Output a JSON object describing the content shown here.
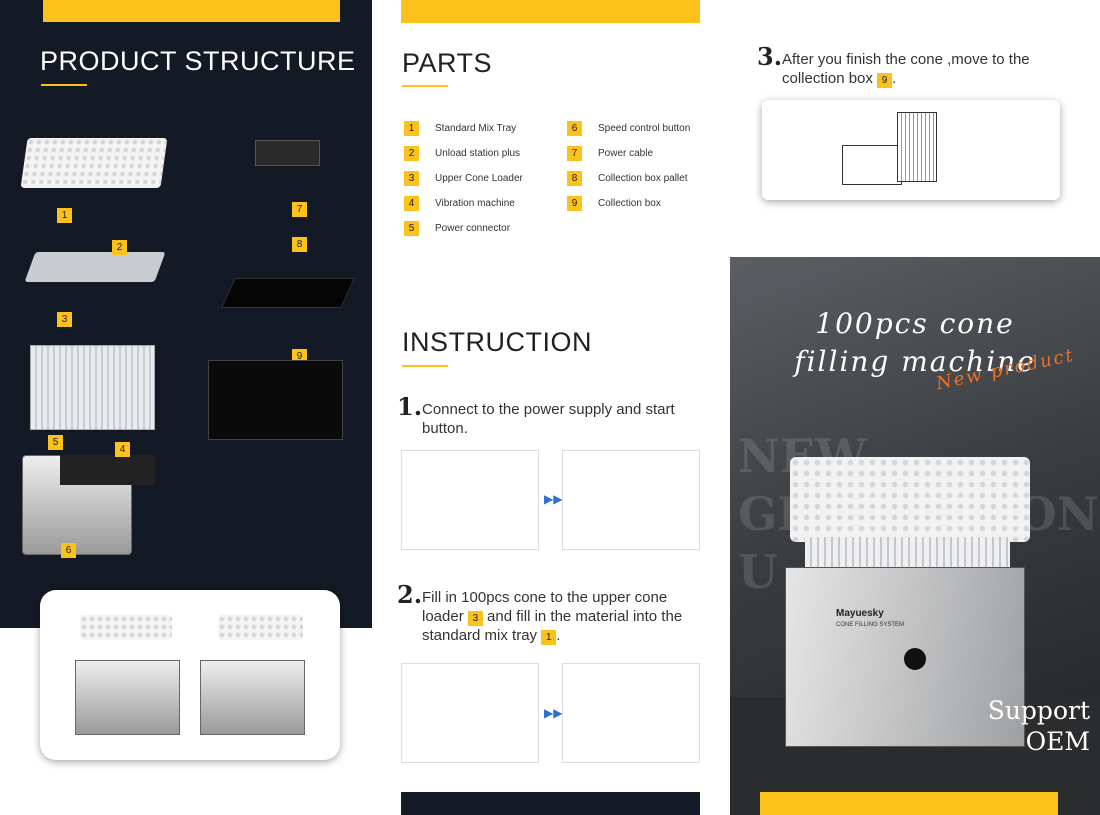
{
  "structure": {
    "title": "PRODUCT STRUCTURE",
    "labels": [
      "1",
      "2",
      "3",
      "4",
      "5",
      "6",
      "7",
      "8",
      "9"
    ]
  },
  "parts": {
    "title": "PARTS",
    "items": [
      {
        "num": "1",
        "label": "Standard Mix Tray"
      },
      {
        "num": "2",
        "label": "Unload station plus"
      },
      {
        "num": "3",
        "label": "Upper Cone Loader"
      },
      {
        "num": "4",
        "label": "Vibration machine"
      },
      {
        "num": "5",
        "label": "Power connector"
      },
      {
        "num": "6",
        "label": "Speed control button"
      },
      {
        "num": "7",
        "label": "Power cable"
      },
      {
        "num": "8",
        "label": "Collection box pallet"
      },
      {
        "num": "9",
        "label": "Collection box"
      }
    ]
  },
  "instruction": {
    "title": "INSTRUCTION",
    "step1": {
      "num": "1.",
      "text": "Connect to the power supply and start button."
    },
    "step2": {
      "num": "2.",
      "text_a": "Fill in 100pcs cone to the upper cone loader",
      "badge_a": "3",
      "text_b": "and fill in the material  into the  standard mix tray",
      "badge_b": "1",
      "text_c": "."
    },
    "step3": {
      "num": "3.",
      "text": "After you finish the cone ,move to the collection box",
      "badge": "9",
      "text_end": "."
    }
  },
  "poster": {
    "title_line1": "100pcs cone",
    "title_line2": "filling machine",
    "tag": "New product",
    "watermark": [
      "NEW",
      "GENERATION",
      "U"
    ],
    "brand": "Mayuesky",
    "brand_sub": "CONE FILLING SYSTEM",
    "support": "Support",
    "oem": "OEM"
  },
  "colors": {
    "accent": "#fcc21b",
    "dark": "#131a26",
    "tag": "#e8712a"
  }
}
